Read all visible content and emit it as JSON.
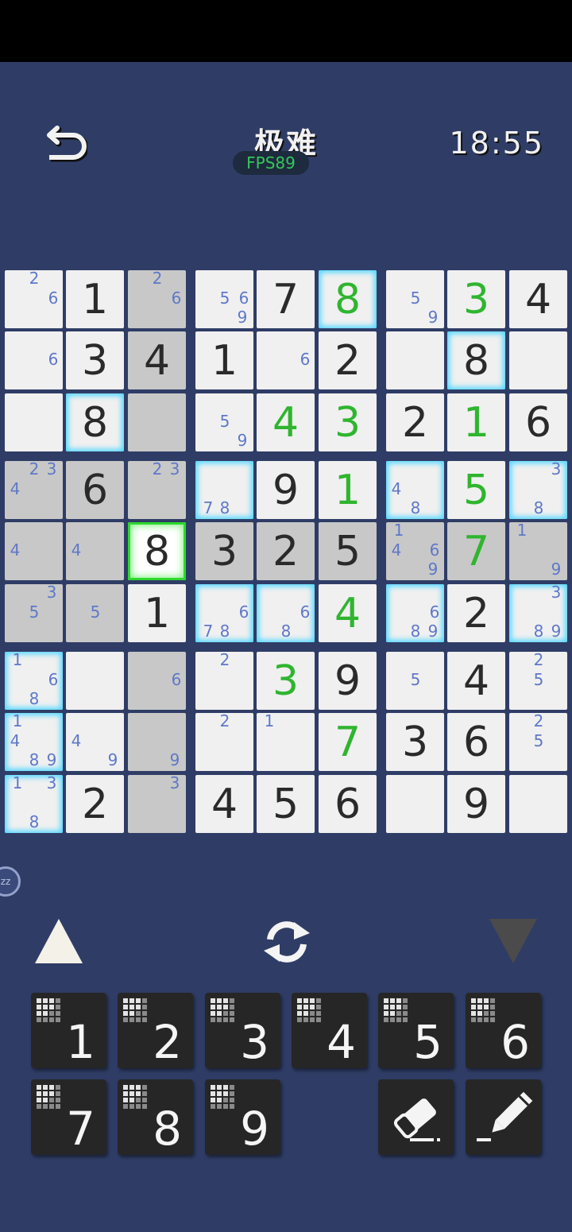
{
  "app": {
    "title": "极难",
    "fps": "FPS89",
    "timer": "18:55"
  },
  "icons": {
    "back": "back-arrow-icon",
    "refresh": "refresh-icon",
    "up": "triangle-up-icon",
    "down": "triangle-down-icon",
    "eraser": "eraser-icon",
    "pencil": "pencil-icon",
    "zzz": "sleep-zzz-icon",
    "key_grid": "notes-grid-icon"
  },
  "zzz_badge": "zz",
  "colors": {
    "background": "#2f3d66",
    "cell": "#f0f0f0",
    "cell_highlight": "#c8c8c8",
    "given": "#2a2a2a",
    "entered": "#2fb52f",
    "note": "#5f78c8",
    "glow": "#55d8ff",
    "selected_border": "#2ed82e",
    "key_background": "#262626"
  },
  "board": {
    "values": [
      [
        0,
        1,
        0,
        0,
        7,
        8,
        0,
        3,
        4
      ],
      [
        0,
        3,
        4,
        1,
        0,
        2,
        0,
        8,
        0
      ],
      [
        0,
        8,
        0,
        0,
        4,
        3,
        2,
        1,
        6
      ],
      [
        0,
        6,
        0,
        0,
        9,
        1,
        0,
        5,
        0
      ],
      [
        0,
        0,
        8,
        3,
        2,
        5,
        0,
        7,
        0
      ],
      [
        0,
        0,
        1,
        0,
        0,
        4,
        0,
        2,
        0
      ],
      [
        0,
        0,
        0,
        0,
        3,
        9,
        0,
        4,
        0
      ],
      [
        0,
        0,
        0,
        0,
        0,
        7,
        3,
        6,
        0
      ],
      [
        0,
        2,
        0,
        4,
        5,
        6,
        0,
        9,
        0
      ]
    ],
    "entered": [
      [
        0,
        0,
        0,
        0,
        0,
        1,
        0,
        1,
        0
      ],
      [
        0,
        0,
        0,
        0,
        0,
        0,
        0,
        0,
        0
      ],
      [
        0,
        0,
        0,
        0,
        1,
        1,
        0,
        1,
        0
      ],
      [
        0,
        0,
        0,
        0,
        0,
        1,
        0,
        1,
        0
      ],
      [
        0,
        0,
        0,
        0,
        0,
        0,
        0,
        1,
        0
      ],
      [
        0,
        0,
        0,
        0,
        0,
        1,
        0,
        0,
        0
      ],
      [
        0,
        0,
        0,
        0,
        1,
        0,
        0,
        0,
        0
      ],
      [
        0,
        0,
        0,
        0,
        0,
        1,
        0,
        0,
        0
      ],
      [
        0,
        0,
        0,
        0,
        0,
        0,
        0,
        0,
        0
      ]
    ],
    "notes": [
      [
        [
          2,
          6
        ],
        [],
        [
          2,
          6
        ],
        [
          5,
          6,
          9
        ],
        [],
        [],
        [
          5,
          9
        ],
        [],
        []
      ],
      [
        [
          6
        ],
        [],
        [],
        [],
        [
          6
        ],
        [],
        [],
        [],
        []
      ],
      [
        [],
        [],
        [],
        [
          5,
          9
        ],
        [],
        [],
        [],
        [],
        []
      ],
      [
        [
          2,
          3,
          4
        ],
        [],
        [
          2,
          3
        ],
        [
          7,
          8
        ],
        [],
        [],
        [
          4,
          8
        ],
        [],
        [
          3,
          8
        ]
      ],
      [
        [
          4
        ],
        [
          4
        ],
        [],
        [],
        [],
        [],
        [
          1,
          4,
          6,
          9
        ],
        [],
        [
          1,
          9
        ]
      ],
      [
        [
          3,
          5
        ],
        [
          5
        ],
        [],
        [
          6,
          7,
          8
        ],
        [
          6,
          8
        ],
        [],
        [
          6,
          8,
          9
        ],
        [],
        [
          3,
          8,
          9
        ]
      ],
      [
        [
          1,
          6,
          8
        ],
        [],
        [
          6
        ],
        [
          2
        ],
        [],
        [],
        [
          5
        ],
        [],
        [
          2,
          5
        ]
      ],
      [
        [
          1,
          4,
          8,
          9
        ],
        [
          4,
          9
        ],
        [
          9
        ],
        [
          2
        ],
        [
          1
        ],
        [],
        [],
        [],
        [
          2,
          5
        ]
      ],
      [
        [
          1,
          3,
          8
        ],
        [],
        [
          3
        ],
        [],
        [],
        [],
        [],
        [],
        []
      ]
    ],
    "highlight": [
      [
        0,
        0,
        1,
        0,
        0,
        0,
        0,
        0,
        0
      ],
      [
        0,
        0,
        1,
        0,
        0,
        0,
        0,
        0,
        0
      ],
      [
        0,
        0,
        1,
        0,
        0,
        0,
        0,
        0,
        0
      ],
      [
        1,
        1,
        1,
        0,
        0,
        0,
        0,
        0,
        0
      ],
      [
        1,
        1,
        0,
        1,
        1,
        1,
        1,
        1,
        1
      ],
      [
        1,
        1,
        0,
        0,
        0,
        0,
        0,
        0,
        0
      ],
      [
        0,
        0,
        1,
        0,
        0,
        0,
        0,
        0,
        0
      ],
      [
        0,
        0,
        1,
        0,
        0,
        0,
        0,
        0,
        0
      ],
      [
        0,
        0,
        1,
        0,
        0,
        0,
        0,
        0,
        0
      ]
    ],
    "glow": [
      [
        0,
        0,
        0,
        0,
        0,
        1,
        0,
        0,
        0
      ],
      [
        0,
        0,
        0,
        0,
        0,
        0,
        0,
        1,
        0
      ],
      [
        0,
        1,
        0,
        0,
        0,
        0,
        0,
        0,
        0
      ],
      [
        0,
        0,
        0,
        1,
        0,
        0,
        1,
        0,
        1
      ],
      [
        0,
        0,
        0,
        0,
        0,
        0,
        0,
        0,
        0
      ],
      [
        0,
        0,
        0,
        1,
        1,
        0,
        1,
        0,
        1
      ],
      [
        1,
        0,
        0,
        0,
        0,
        0,
        0,
        0,
        0
      ],
      [
        1,
        0,
        0,
        0,
        0,
        0,
        0,
        0,
        0
      ],
      [
        1,
        0,
        0,
        0,
        0,
        0,
        0,
        0,
        0
      ]
    ],
    "selected": {
      "row": 4,
      "col": 2
    }
  },
  "keypad": {
    "numbers": [
      "1",
      "2",
      "3",
      "4",
      "5",
      "6",
      "7",
      "8",
      "9"
    ],
    "tools": [
      {
        "name": "eraser",
        "icon": "eraser-icon"
      },
      {
        "name": "pencil",
        "icon": "pencil-icon"
      }
    ]
  }
}
